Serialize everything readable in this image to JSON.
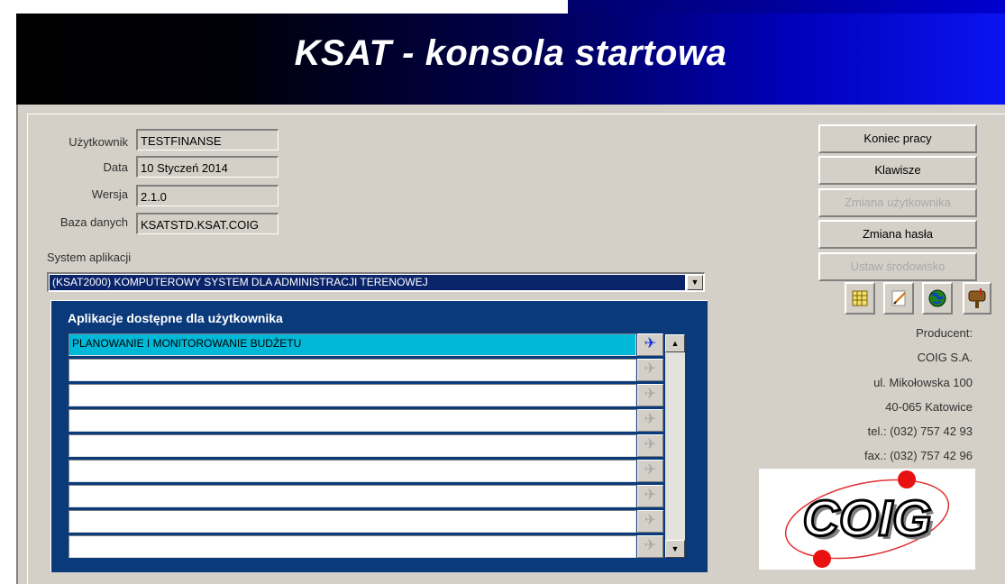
{
  "header": {
    "title": "KSAT - konsola startowa"
  },
  "user_info": {
    "user_label": "Użytkownik",
    "user_value": "TESTFINANSE",
    "date_label": "Data",
    "date_value": "10 Styczeń   2014",
    "version_label": "Wersja",
    "version_value": "2.1.0",
    "db_label": "Baza danych",
    "db_value": "KSATSTD.KSAT.COIG"
  },
  "system": {
    "label": "System aplikacji",
    "selected": "(KSAT2000) KOMPUTEROWY SYSTEM DLA ADMINISTRACJI TERENOWEJ"
  },
  "applications": {
    "title": "Aplikacje dostępne dla użytkownika",
    "rows": [
      "PLANOWANIE I MONITOROWANIE BUDŻETU",
      "",
      "",
      "",
      "",
      "",
      "",
      "",
      ""
    ]
  },
  "buttons": {
    "end_work": "Koniec pracy",
    "keys": "Klawisze",
    "change_user": "Zmiana użytkownika",
    "change_password": "Zmiana hasła",
    "set_environment": "Ustaw środowisko"
  },
  "producer": {
    "label": "Producent:",
    "name": "COIG S.A.",
    "street": "ul. Mikołowska 100",
    "city": "40-065 Katowice",
    "tel": "tel.: (032) 757 42 93",
    "fax": "fax.: (032) 757 42 96",
    "logo_text": "COIG"
  },
  "colors": {
    "banner_dark": "#000000",
    "banner_light": "#0a14f0",
    "selection": "#00b8d8",
    "panel": "#d4d0c8"
  }
}
